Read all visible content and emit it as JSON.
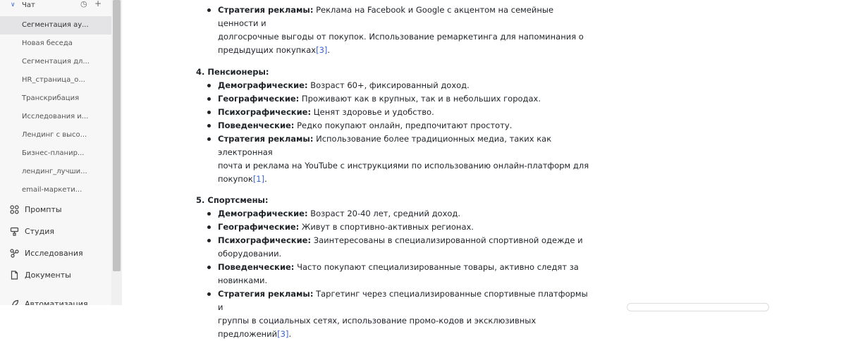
{
  "sidebar": {
    "section_label": "Чат",
    "chats": [
      "Сегментация ау...",
      "Новая беседа",
      "Сегментация дл...",
      "HR_страница_о...",
      "Транскрибация",
      "Исследования и...",
      "Лендинг с высо...",
      "Бизнес-планир...",
      "лендинг_лучши...",
      "email-маркети..."
    ],
    "nav": [
      "Промпты",
      "Студия",
      "Исследования",
      "Документы",
      "Автоматизация"
    ]
  },
  "content": {
    "top_item": {
      "key": "Стратегия рекламы:",
      "line1": " Реклама на Facebook и Google с акцентом на семейные ценности и",
      "line2": "долгосрочные выгоды от покупок. Использование ремаркетинга для напоминания о",
      "line3": "предыдущих покупках",
      "ref": "[3]"
    },
    "sections": [
      {
        "title": "4. Пенсионеры:",
        "items": [
          {
            "key": "Демографические:",
            "text": " Возраст 60+, фиксированный доход."
          },
          {
            "key": "Географические:",
            "text": " Проживают как в крупных, так и в небольших городах."
          },
          {
            "key": "Психографические:",
            "text": " Ценят здоровье и удобство."
          },
          {
            "key": "Поведенческие:",
            "text": " Редко покупают онлайн, предпочитают простоту."
          },
          {
            "key": "Стратегия рекламы:",
            "text": " Использование более традиционных медиа, таких как электронная",
            "text2": "почта и реклама на YouTube с инструкциями по использованию онлайн-платформ для",
            "text3": "покупок",
            "ref": "[1]"
          }
        ]
      },
      {
        "title": "5. Спортсмены:",
        "items": [
          {
            "key": "Демографические:",
            "text": " Возраст 20-40 лет, средний доход."
          },
          {
            "key": "Географические:",
            "text": " Живут в спортивно-активных регионах."
          },
          {
            "key": "Психографические:",
            "text": " Заинтересованы в специализированной спортивной одежде и",
            "text2": "оборудовании."
          },
          {
            "key": "Поведенческие:",
            "text": " Часто покупают специализированные товары, активно следят за",
            "text2": "новинками."
          },
          {
            "key": "Стратегия рекламы:",
            "text": " Таргетинг через специализированные спортивные платформы и",
            "text2": "группы в социальных сетях, использование промо-кодов и эксклюзивных",
            "text3": "предложений",
            "ref": "[3]"
          }
        ]
      }
    ]
  },
  "colors": {
    "accent": "#3b63d6",
    "sidebar_bg": "#f7f7f8",
    "active_bg": "#e4e4e6"
  }
}
